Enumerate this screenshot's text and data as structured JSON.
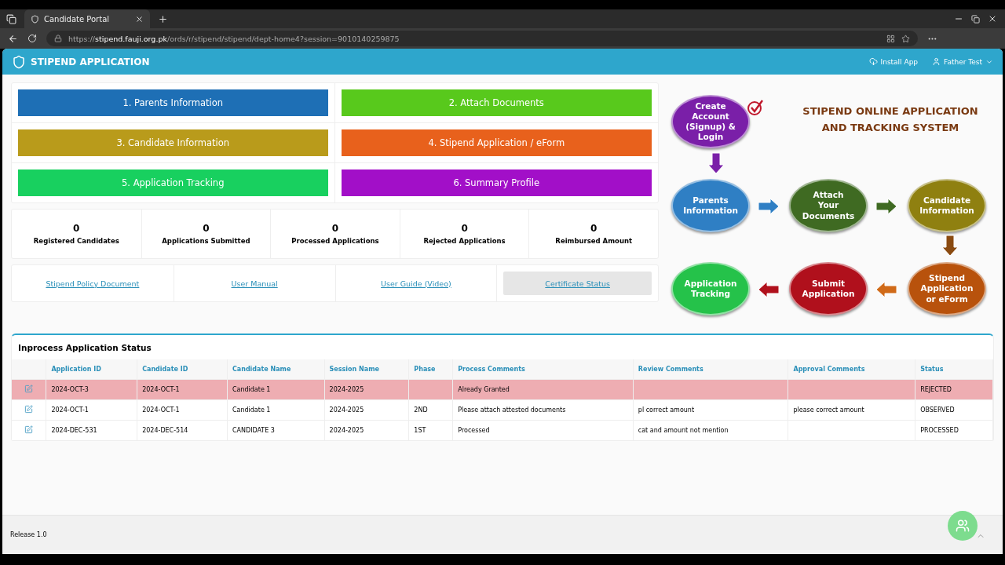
{
  "browser": {
    "tab_title": "Candidate Portal",
    "url_host": "stipend.fauji.org.pk",
    "url_prefix": "https://",
    "url_path": "/ords/r/stipend/stipend/dept-home4?session=9010140259875"
  },
  "header": {
    "title": "STIPEND APPLICATION",
    "install": "Install App",
    "user": "Father Test"
  },
  "nav_buttons": [
    {
      "label": "1. Parents Information",
      "color": "#1e6fb5"
    },
    {
      "label": "2. Attach Documents",
      "color": "#58c91c"
    },
    {
      "label": "3. Candidate Information",
      "color": "#b99b1b"
    },
    {
      "label": "4. Stipend Application / eForm",
      "color": "#e8611c"
    },
    {
      "label": "5. Application Tracking",
      "color": "#18d05f"
    },
    {
      "label": "6. Summary Profile",
      "color": "#a20fc8"
    }
  ],
  "stats": [
    {
      "value": "0",
      "label": "Registered Candidates"
    },
    {
      "value": "0",
      "label": "Applications Submitted"
    },
    {
      "value": "0",
      "label": "Processed Applications"
    },
    {
      "value": "0",
      "label": "Rejected Applications"
    },
    {
      "value": "0",
      "label": "Reimbursed Amount"
    }
  ],
  "links": [
    {
      "label": "Stipend Policy Document",
      "selected": false
    },
    {
      "label": "User Manual",
      "selected": false
    },
    {
      "label": "User Guide (Video)",
      "selected": false
    },
    {
      "label": "Certificate Status",
      "selected": true
    }
  ],
  "diagram": {
    "title": "STIPEND ONLINE APPLICATION AND TRACKING SYSTEM",
    "nodes": [
      {
        "label": "Create Account (Signup) & Login",
        "color": "#7a1fa8"
      },
      {
        "label": "Parents Information",
        "color": "#2f7fc4"
      },
      {
        "label": "Attach Your Documents",
        "color": "#3f6a22"
      },
      {
        "label": "Candidate Information",
        "color": "#8f8010"
      },
      {
        "label": "Application Tracking",
        "color": "#25c24a"
      },
      {
        "label": "Submit Application",
        "color": "#b0101c"
      },
      {
        "label": "Stipend Application or eForm",
        "color": "#b8520c"
      }
    ]
  },
  "table": {
    "title": "Inprocess Application Status",
    "columns": [
      "Application ID",
      "Candidate ID",
      "Candidate Name",
      "Session Name",
      "Phase",
      "Process Comments",
      "Review Comments",
      "Approval Comments",
      "Status"
    ],
    "rows": [
      {
        "highlighted": true,
        "cells": [
          "2024-OCT-3",
          "2024-OCT-1",
          "Candidate 1",
          "2024-2025",
          "",
          "Already Granted",
          "",
          "",
          "REJECTED"
        ]
      },
      {
        "highlighted": false,
        "cells": [
          "2024-OCT-1",
          "2024-OCT-1",
          "Candidate 1",
          "2024-2025",
          "2ND",
          "Please attach attested documents",
          "pl correct amount",
          "please correct amount",
          "OBSERVED"
        ]
      },
      {
        "highlighted": false,
        "cells": [
          "2024-DEC-531",
          "2024-DEC-514",
          "CANDIDATE 3",
          "2024-2025",
          "1ST",
          "Processed",
          "cat and amount not mention",
          "",
          "PROCESSED"
        ]
      }
    ]
  },
  "footer": {
    "release": "Release 1.0"
  }
}
